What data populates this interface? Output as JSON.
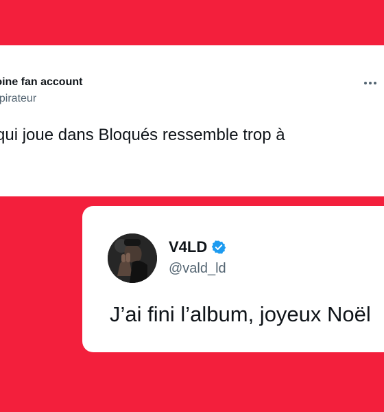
{
  "tweet1": {
    "display_name": "toine fan account",
    "handle": "aspirateur",
    "text": "qui joue dans Bloqués ressemble trop à",
    "more_icon": "more-dots-icon"
  },
  "tweet2": {
    "display_name": "V4LD",
    "handle": "@vald_ld",
    "text": "J’ai fini l’album, joyeux Noël",
    "verified_icon": "verified-badge-icon",
    "avatar": "user-avatar-photo"
  },
  "colors": {
    "background": "#f31f3c",
    "card": "#ffffff",
    "text_primary": "#0f1419",
    "text_secondary": "#536471",
    "verified": "#1d9bf0"
  }
}
